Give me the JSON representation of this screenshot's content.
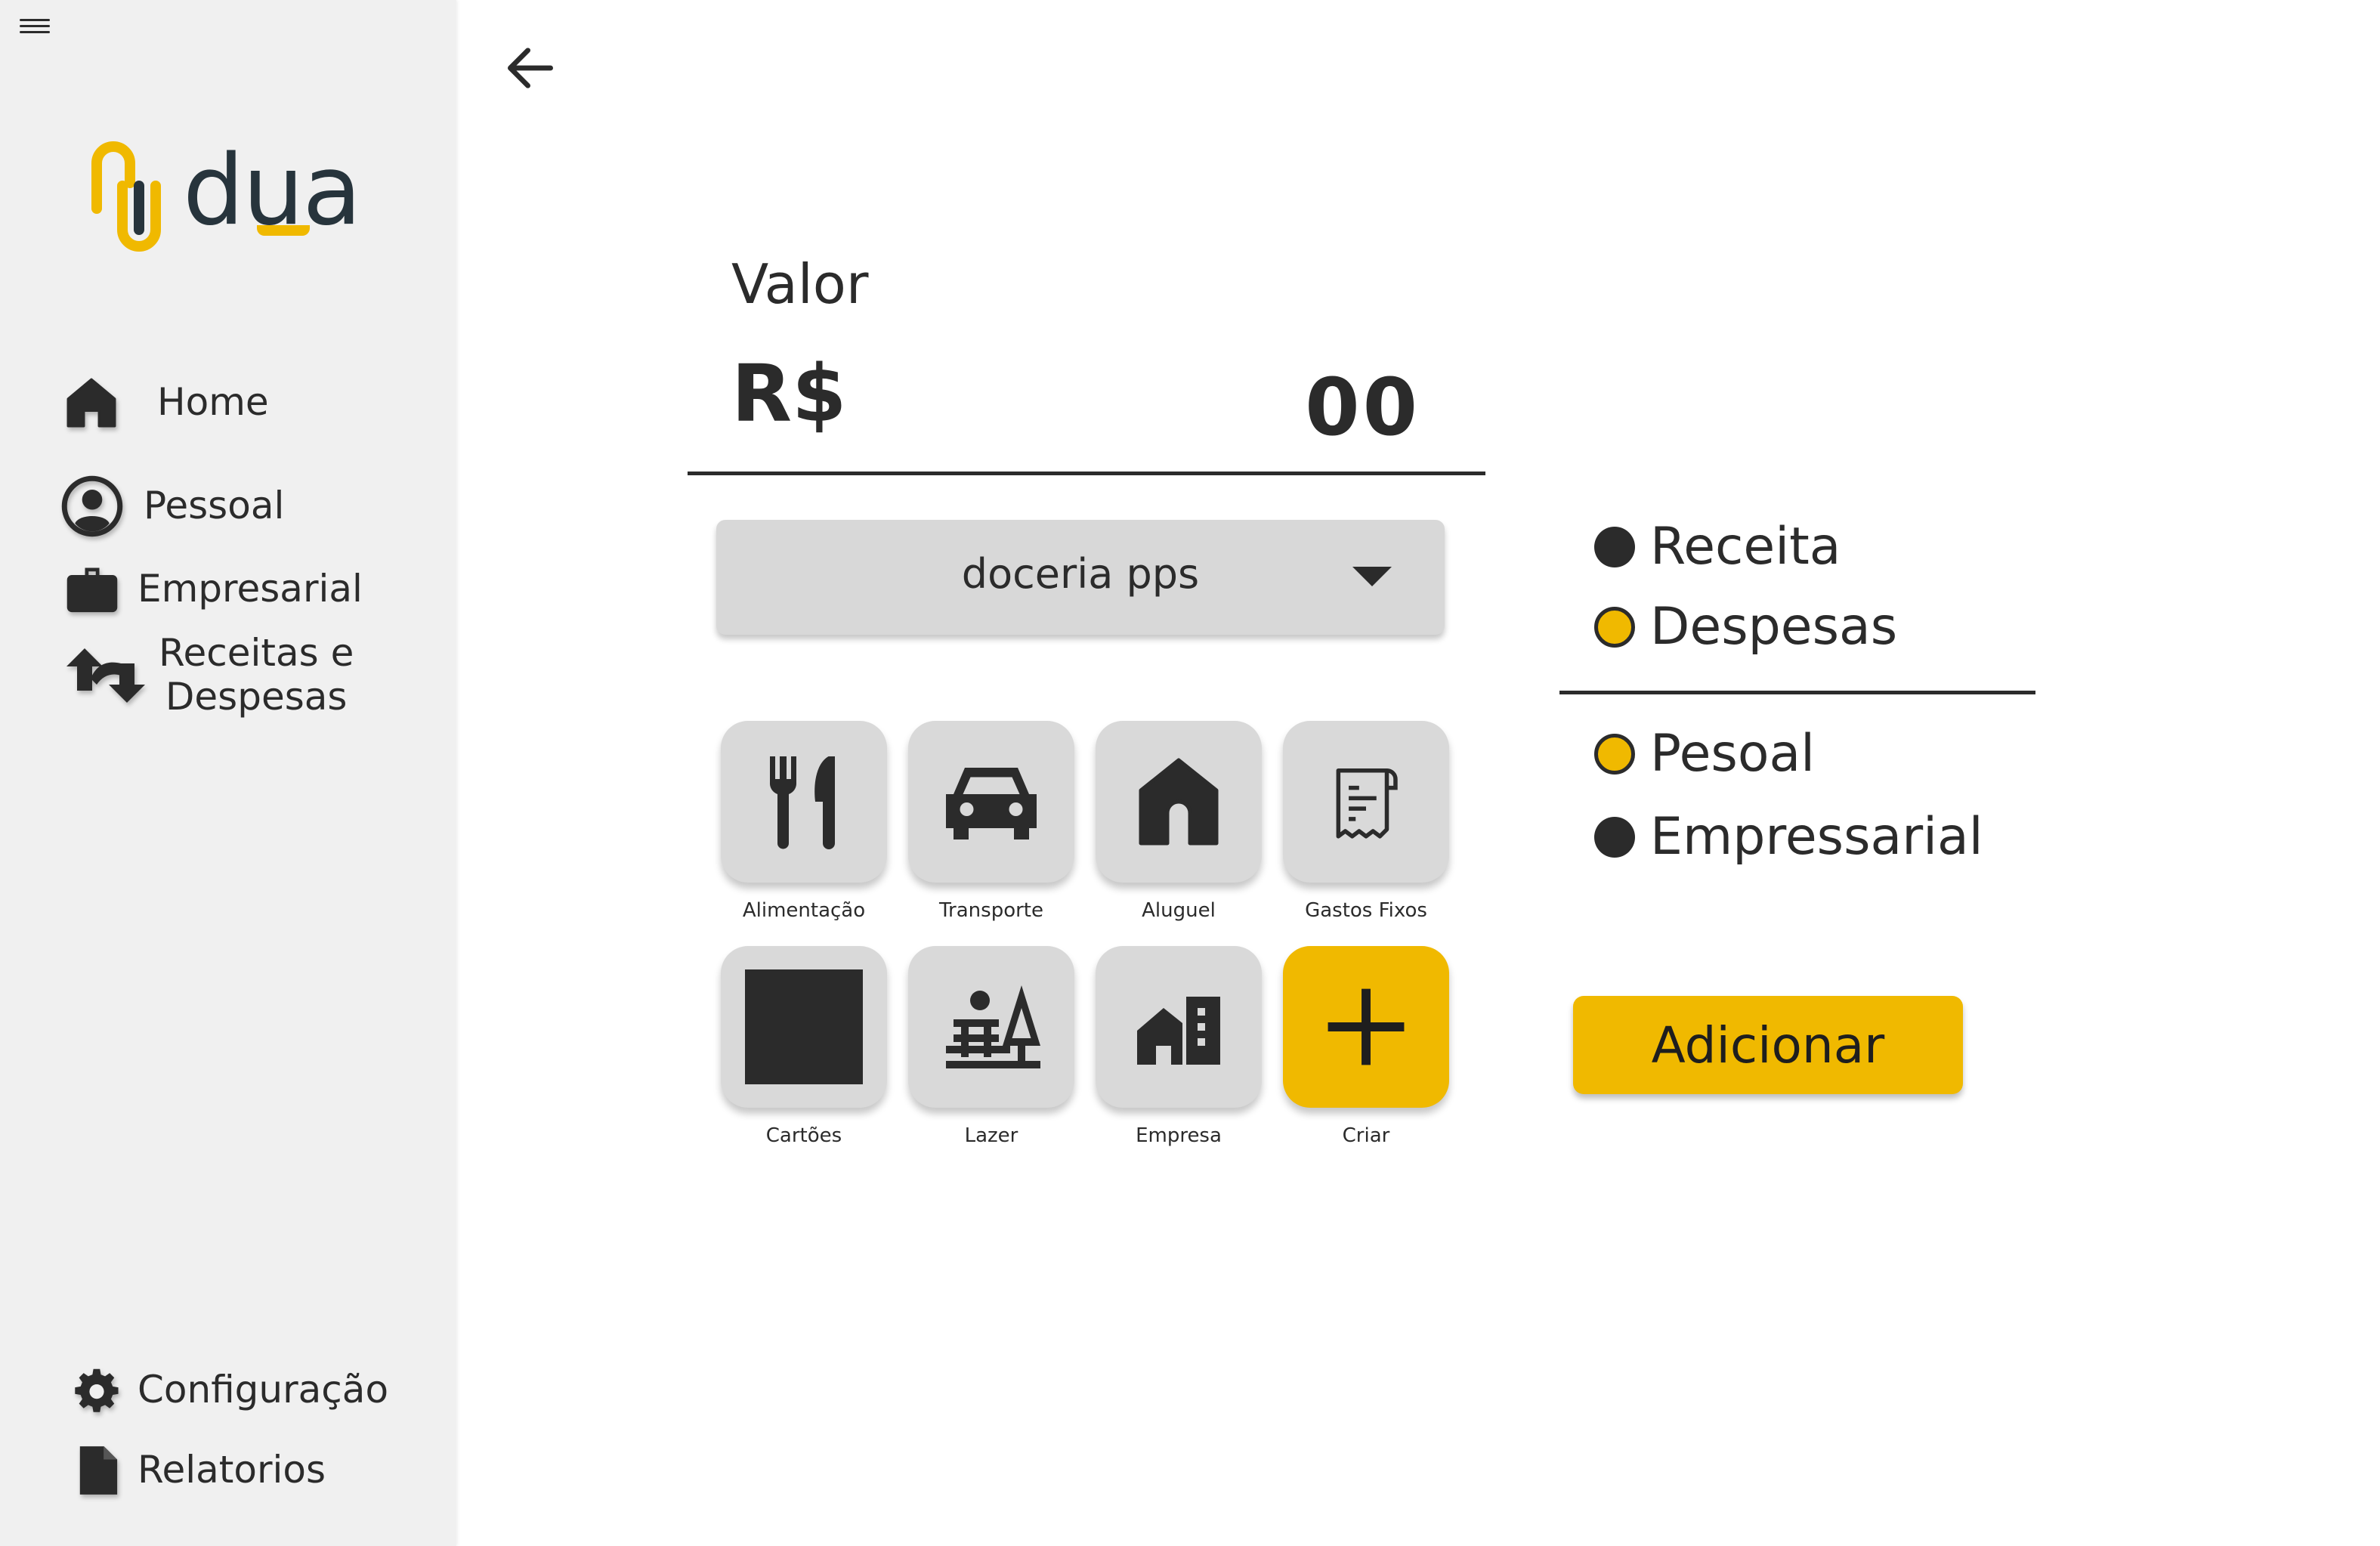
{
  "sidebar": {
    "logo_text": "dua",
    "items": [
      {
        "label": "Home",
        "icon": "home-icon"
      },
      {
        "label": "Pessoal",
        "icon": "user-icon"
      },
      {
        "label": "Empresarial",
        "icon": "briefcase-icon"
      },
      {
        "label_line1": "Receitas e",
        "label_line2": "Despesas",
        "icon": "sync-arrows-icon"
      }
    ],
    "bottom_items": [
      {
        "label": "Configuração",
        "icon": "gear-icon"
      },
      {
        "label": "Relatorios",
        "icon": "document-icon"
      }
    ]
  },
  "main": {
    "valor_label": "Valor",
    "currency": "R$",
    "amount": "00",
    "dropdown_selected": "doceria pps",
    "categories": [
      {
        "label": "Alimentação",
        "icon": "fork-knife-icon"
      },
      {
        "label": "Transporte",
        "icon": "car-icon"
      },
      {
        "label": "Aluguel",
        "icon": "house-icon"
      },
      {
        "label": "Gastos Fixos",
        "icon": "receipt-icon"
      },
      {
        "label": "Cartões",
        "icon": "square-icon"
      },
      {
        "label": "Lazer",
        "icon": "park-icon"
      },
      {
        "label": "Empresa",
        "icon": "buildings-icon"
      },
      {
        "label": "Criar",
        "icon": "plus-icon"
      }
    ],
    "type_options": [
      {
        "label": "Receita",
        "selected": false
      },
      {
        "label": "Despesas",
        "selected": true
      }
    ],
    "scope_options": [
      {
        "label": "Pesoal",
        "selected": true
      },
      {
        "label": "Empressarial",
        "selected": false
      }
    ],
    "submit_label": "Adicionar"
  },
  "colors": {
    "accent": "#f0b900",
    "dark": "#2b2b2b",
    "tile": "#d9d9d9",
    "sidebar_bg": "#f0f0f0"
  }
}
